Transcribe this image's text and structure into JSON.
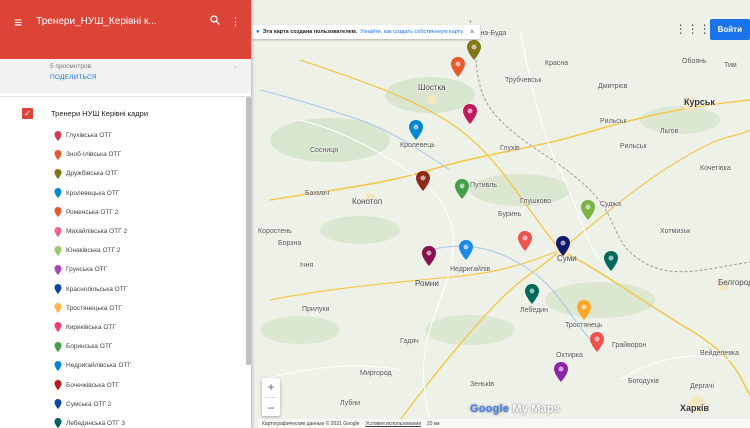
{
  "header": {
    "title": "Тренери_НУШ_Керівні к...",
    "menu_icon": "menu-icon",
    "search_icon": "search-icon",
    "more_icon": "more-vert-icon",
    "color": "#db4437"
  },
  "meta": {
    "views": "5 просмотров",
    "share": "ПОДЕЛИТЬСЯ"
  },
  "layer": {
    "name": "Тренери НУШ Керівні кадри",
    "checked": true
  },
  "items": [
    {
      "label": "Глухівська ОТГ",
      "color": "#d23f57"
    },
    {
      "label": "Зноб-Ілівська ОТГ",
      "color": "#e65a2e"
    },
    {
      "label": "Дружбівська ОТГ",
      "color": "#827717"
    },
    {
      "label": "Кролевецька ОТГ",
      "color": "#0288d1"
    },
    {
      "label": "Роменська ОТГ 2",
      "color": "#e65a2e"
    },
    {
      "label": "Михайлівська ОТГ 2",
      "color": "#f06292"
    },
    {
      "label": "Юнаківська ОТГ 2",
      "color": "#9ccc65"
    },
    {
      "label": "Грунська ОТГ",
      "color": "#ab47bc"
    },
    {
      "label": "Краснопільська ОТГ",
      "color": "#0d47a1"
    },
    {
      "label": "Тростянецька ОТГ",
      "color": "#ffb74d"
    },
    {
      "label": "Кириківська ОТГ",
      "color": "#ec407a"
    },
    {
      "label": "Боринська ОТГ",
      "color": "#43a047"
    },
    {
      "label": "Недригайлівська ОТГ",
      "color": "#0288d1"
    },
    {
      "label": "Бочечківська ОТГ",
      "color": "#b71c1c"
    },
    {
      "label": "Сумська ОТГ 2",
      "color": "#0d47a1"
    },
    {
      "label": "Лебединська ОТГ 3",
      "color": "#006064"
    }
  ],
  "map": {
    "banner_text": "Эта карта создана пользователем.",
    "banner_link": "Узнайте, как создать собственную карту.",
    "login": "Войти",
    "zoom_in": "+",
    "zoom_out": "−",
    "footer_data": "Картографические данные © 2021 Google",
    "footer_terms": "Условия использования",
    "footer_scale": "20 км",
    "logo_google": "Google",
    "logo_mymaps": " My Maps",
    "places": [
      {
        "name": "Шостка",
        "cls": "mid"
      },
      {
        "name": "Кролевець",
        "cls": ""
      },
      {
        "name": "Конотоп",
        "cls": "mid"
      },
      {
        "name": "Путивль",
        "cls": ""
      },
      {
        "name": "Буринь",
        "cls": ""
      },
      {
        "name": "Глухів",
        "cls": ""
      },
      {
        "name": "Суми",
        "cls": "mid"
      },
      {
        "name": "Ромни",
        "cls": "mid"
      },
      {
        "name": "Лебедин",
        "cls": ""
      },
      {
        "name": "Тростянець",
        "cls": ""
      },
      {
        "name": "Охтирка",
        "cls": ""
      },
      {
        "name": "Харків",
        "cls": "big"
      },
      {
        "name": "Курськ",
        "cls": "big"
      },
      {
        "name": "Белгород",
        "cls": "mid"
      },
      {
        "name": "Прилуки",
        "cls": ""
      },
      {
        "name": "Миргород",
        "cls": ""
      },
      {
        "name": "Лубни",
        "cls": ""
      },
      {
        "name": "Суджа",
        "cls": ""
      },
      {
        "name": "Недригайлів",
        "cls": ""
      },
      {
        "name": "Трубчевськ",
        "cls": ""
      },
      {
        "name": "Бахмач",
        "cls": ""
      },
      {
        "name": "Сосниця",
        "cls": ""
      },
      {
        "name": "Льгов",
        "cls": ""
      },
      {
        "name": "Рильськ",
        "cls": ""
      },
      {
        "name": "Рильськ",
        "cls": ""
      },
      {
        "name": "Богодухів",
        "cls": ""
      },
      {
        "name": "Зеньків",
        "cls": ""
      },
      {
        "name": "Гадяч",
        "cls": ""
      },
      {
        "name": "Дергачі",
        "cls": ""
      },
      {
        "name": "Вейделевка",
        "cls": ""
      },
      {
        "name": "Дмитрієв",
        "cls": ""
      },
      {
        "name": "Ічня",
        "cls": ""
      },
      {
        "name": "Борзна",
        "cls": ""
      },
      {
        "name": "Серединна-Буда",
        "cls": ""
      },
      {
        "name": "Глушково",
        "cls": ""
      },
      {
        "name": "Обоянь",
        "cls": ""
      },
      {
        "name": "Тим",
        "cls": ""
      },
      {
        "name": "Грайворон",
        "cls": ""
      },
      {
        "name": "Красна",
        "cls": ""
      },
      {
        "name": "Хотмизьк",
        "cls": ""
      },
      {
        "name": "Кочетівка",
        "cls": ""
      },
      {
        "name": "Коростень",
        "cls": ""
      }
    ]
  }
}
